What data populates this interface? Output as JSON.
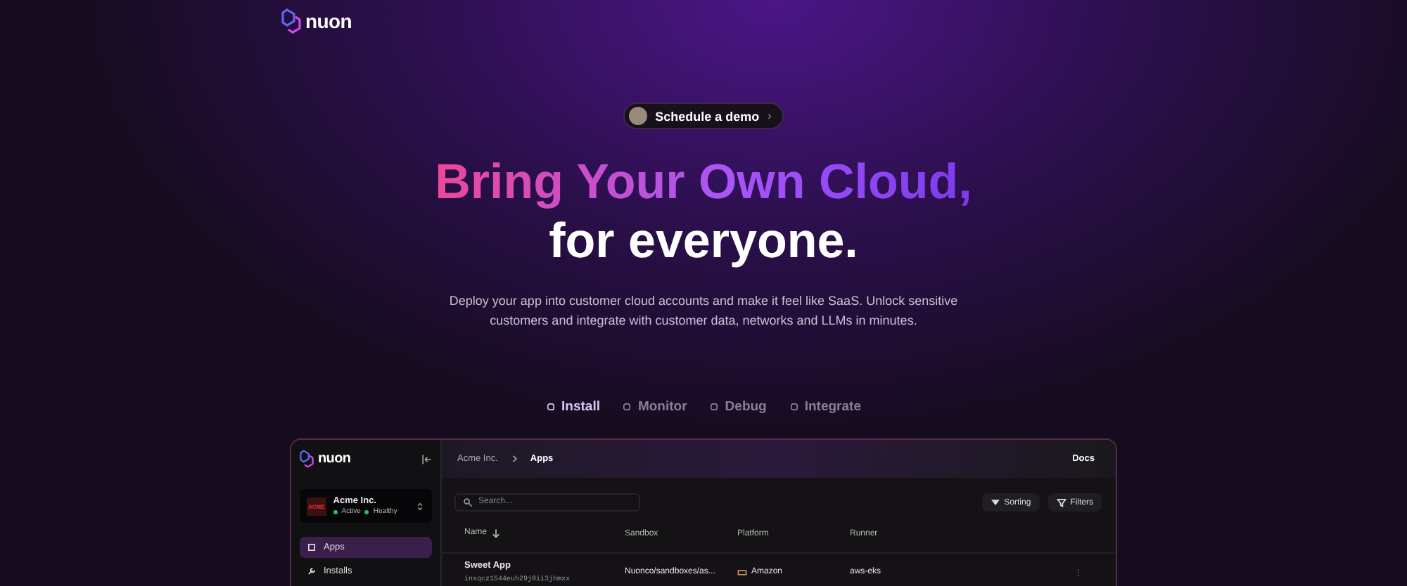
{
  "brand": "nuon",
  "cta": {
    "label": "Schedule a demo",
    "arrow": "›"
  },
  "headline": {
    "line_1": "Bring Your Own Cloud,",
    "line_2": "for everyone."
  },
  "description": "Deploy your app into customer cloud accounts and make it feel like SaaS. Unlock sensitive customers and integrate with customer data, networks and LLMs in minutes.",
  "feature_tabs": [
    {
      "label": "Install",
      "selected": true
    },
    {
      "label": "Monitor",
      "selected": false
    },
    {
      "label": "Debug",
      "selected": false
    },
    {
      "label": "Integrate",
      "selected": false
    }
  ],
  "app_preview": {
    "brand": "nuon",
    "org": {
      "logo_text": "ACME",
      "name": "Acme Inc.",
      "statuses": [
        {
          "label": "Active",
          "color": "#22c55e"
        },
        {
          "label": "Healthy",
          "color": "#22c55e"
        }
      ]
    },
    "nav": [
      {
        "label": "Apps",
        "selected": true
      },
      {
        "label": "Installs",
        "selected": false
      }
    ],
    "breadcrumb": [
      "Acme Inc.",
      "Apps"
    ],
    "docs": "Docs",
    "search": {
      "placeholder": "Search..."
    },
    "sorting": "Sorting",
    "filters": "Filters",
    "columns": [
      "Name",
      "Sandbox",
      "Platform",
      "Runner"
    ],
    "rows": [
      {
        "name": "Sweet App",
        "id": "inxqcz1544euh29j0ii3jhmxx",
        "sandbox": "Nuonco/sandboxes/as...",
        "platform": "Amazon",
        "runner": "aws-eks"
      }
    ]
  }
}
